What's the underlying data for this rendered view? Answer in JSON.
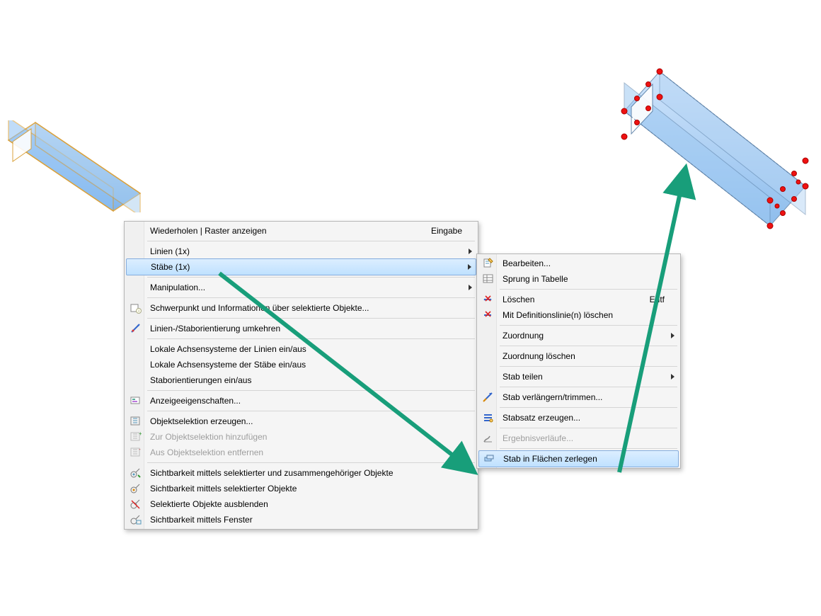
{
  "beams": {
    "left_selected": true,
    "right_has_nodes": true
  },
  "menu1": {
    "items": [
      {
        "label": "Wiederholen | Raster anzeigen",
        "accel": "Eingabe"
      },
      {
        "sep": true
      },
      {
        "label": "Linien (1x)",
        "sub": true
      },
      {
        "label": "Stäbe (1x)",
        "sub": true,
        "highlight": true
      },
      {
        "sep": true
      },
      {
        "label": "Manipulation...",
        "sub": true
      },
      {
        "sep": true
      },
      {
        "label": "Schwerpunkt und Informationen über selektierte Objekte...",
        "icon": "info"
      },
      {
        "sep": true
      },
      {
        "label": "Linien-/Staborientierung umkehren",
        "icon": "orient"
      },
      {
        "sep": true
      },
      {
        "label": "Lokale Achsensysteme der Linien ein/aus"
      },
      {
        "label": "Lokale Achsensysteme der Stäbe ein/aus"
      },
      {
        "label": "Staborientierungen ein/aus"
      },
      {
        "sep": true
      },
      {
        "label": "Anzeigeeigenschaften...",
        "icon": "display"
      },
      {
        "sep": true
      },
      {
        "label": "Objektselektion erzeugen...",
        "icon": "sel-make"
      },
      {
        "label": "Zur Objektselektion hinzufügen",
        "icon": "sel-add",
        "disabled": true
      },
      {
        "label": "Aus Objektselektion entfernen",
        "icon": "sel-rem",
        "disabled": true
      },
      {
        "sep": true
      },
      {
        "label": "Sichtbarkeit mittels selektierter und zusammengehöriger Objekte",
        "icon": "vis1"
      },
      {
        "label": "Sichtbarkeit mittels selektierter Objekte",
        "icon": "vis2"
      },
      {
        "label": "Selektierte Objekte ausblenden",
        "icon": "vis3"
      },
      {
        "label": "Sichtbarkeit mittels Fenster",
        "icon": "vis4"
      }
    ]
  },
  "menu2": {
    "items": [
      {
        "label": "Bearbeiten...",
        "icon": "edit"
      },
      {
        "label": "Sprung in Tabelle",
        "icon": "table"
      },
      {
        "sep": true
      },
      {
        "label": "Löschen",
        "icon": "del",
        "accel": "Entf"
      },
      {
        "label": "Mit Definitionslinie(n) löschen",
        "icon": "del-line"
      },
      {
        "sep": true
      },
      {
        "label": "Zuordnung",
        "sub": true
      },
      {
        "sep": true
      },
      {
        "label": "Zuordnung löschen"
      },
      {
        "sep": true
      },
      {
        "label": "Stab teilen",
        "sub": true
      },
      {
        "sep": true
      },
      {
        "label": "Stab verlängern/trimmen...",
        "icon": "extend"
      },
      {
        "sep": true
      },
      {
        "label": "Stabsatz erzeugen...",
        "icon": "set"
      },
      {
        "sep": true
      },
      {
        "label": "Ergebnisverläufe...",
        "icon": "results",
        "disabled": true
      },
      {
        "sep": true
      },
      {
        "label": "Stab in Flächen zerlegen",
        "icon": "explode",
        "highlight": true
      }
    ]
  }
}
